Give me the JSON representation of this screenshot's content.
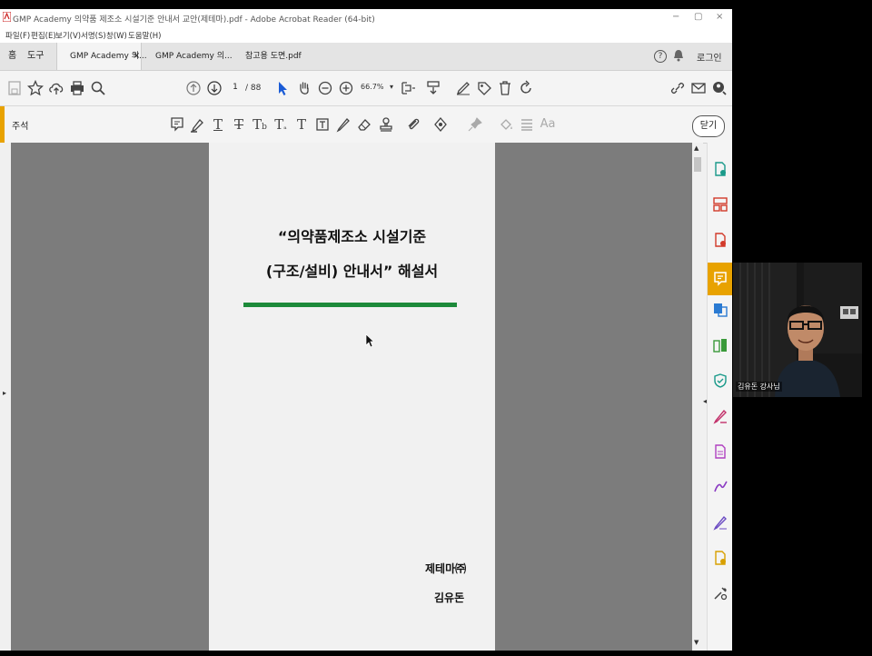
{
  "window": {
    "title": "GMP Academy 의약품 제조소 시설기준 안내서 교안(제테마).pdf - Adobe Acrobat Reader (64-bit)"
  },
  "menu": [
    "파일(F)",
    "편집(E)",
    "보기(V)",
    "서명(S)",
    "창(W)",
    "도움말(H)"
  ],
  "tabs": {
    "home": "홈",
    "tools": "도구",
    "doc_tabs": [
      "GMP Academy 의...",
      "GMP Academy 의...",
      "참고용 도면.pdf"
    ],
    "close_glyph": "×",
    "login": "로그인"
  },
  "toolbar": {
    "page_current": "1",
    "page_total": "/ 88",
    "zoom": "66.7%"
  },
  "comment_bar": {
    "label": "주석",
    "close_label": "닫기"
  },
  "document": {
    "title_line1": "“의약품제조소 시설기준",
    "title_line2": "(구조/설비) 안내서” 해설서",
    "rule_color": "#1d8a3a",
    "company": "제테마㈜",
    "author": "김유돈"
  },
  "video": {
    "caption": "김유돈 강사님"
  },
  "colors": {
    "accent_yellow": "#e8a200",
    "cursor_blue": "#1a5bd6",
    "acrobat_red": "#cc2222"
  }
}
